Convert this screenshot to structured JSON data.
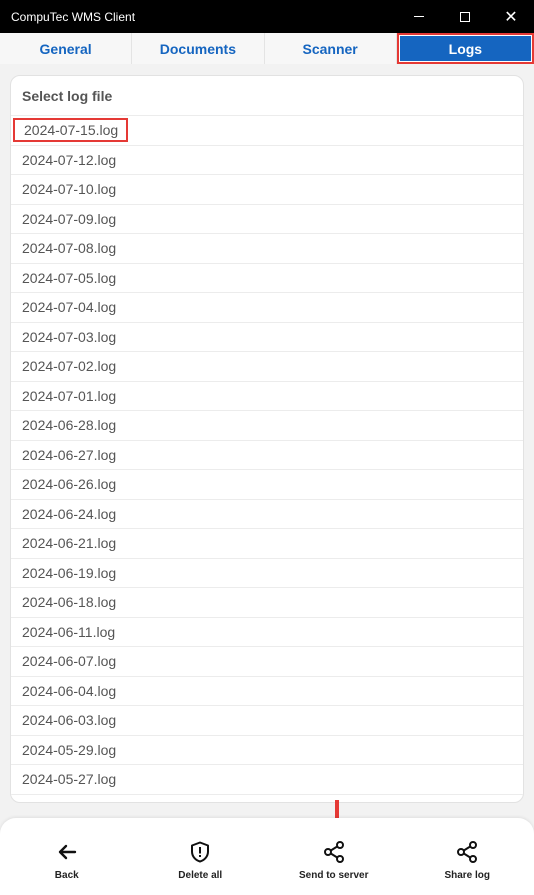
{
  "window": {
    "title": "CompuTec WMS Client",
    "minimize_icon": "minimize-icon",
    "maximize_icon": "maximize-icon",
    "close_icon": "close-icon",
    "close_glyph": "✕"
  },
  "tabs": [
    {
      "label": "General",
      "active": false
    },
    {
      "label": "Documents",
      "active": false
    },
    {
      "label": "Scanner",
      "active": false
    },
    {
      "label": "Logs",
      "active": true
    }
  ],
  "log_list": {
    "header": "Select log file",
    "items": [
      "2024-07-15.log",
      "2024-07-12.log",
      "2024-07-10.log",
      "2024-07-09.log",
      "2024-07-08.log",
      "2024-07-05.log",
      "2024-07-04.log",
      "2024-07-03.log",
      "2024-07-02.log",
      "2024-07-01.log",
      "2024-06-28.log",
      "2024-06-27.log",
      "2024-06-26.log",
      "2024-06-24.log",
      "2024-06-21.log",
      "2024-06-19.log",
      "2024-06-18.log",
      "2024-06-11.log",
      "2024-06-07.log",
      "2024-06-04.log",
      "2024-06-03.log",
      "2024-05-29.log",
      "2024-05-27.log"
    ],
    "highlighted_index": 0
  },
  "bottom_bar": {
    "back": {
      "label": "Back",
      "icon": "arrow-left-icon"
    },
    "delete_all": {
      "label": "Delete all",
      "icon": "shield-alert-icon"
    },
    "send_to_server": {
      "label": "Send to server",
      "icon": "share-icon"
    },
    "share_log": {
      "label": "Share log",
      "icon": "share-icon"
    }
  },
  "colors": {
    "accent": "#1565c0",
    "highlight_border": "#e53935",
    "titlebar": "#000000"
  }
}
